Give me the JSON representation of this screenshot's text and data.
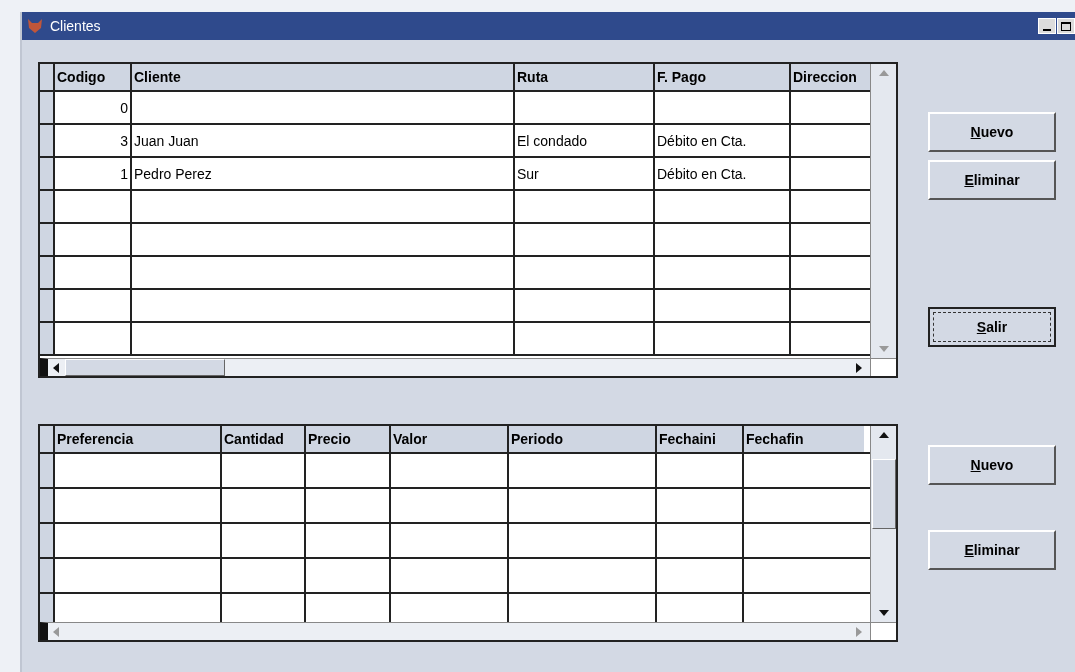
{
  "window": {
    "title": "Clientes"
  },
  "clientes_grid": {
    "columns": [
      "Codigo",
      "Cliente",
      "Ruta",
      "F. Pago",
      "Direccion"
    ],
    "rows": [
      [
        "0",
        "",
        "",
        "",
        ""
      ],
      [
        "3",
        "Juan Juan",
        "El condado",
        "Débito en Cta.",
        ""
      ],
      [
        "1",
        "Pedro Perez",
        "Sur",
        "Débito en Cta.",
        ""
      ]
    ]
  },
  "top_buttons": [
    {
      "label": "Nuevo",
      "underline_first": true,
      "focused": false
    },
    {
      "label": "Eliminar",
      "underline_first": true,
      "focused": false
    },
    {
      "label": "Salir",
      "underline_first": true,
      "focused": true
    }
  ],
  "preferencias_grid": {
    "columns": [
      "Preferencia",
      "Cantidad",
      "Precio",
      "Valor",
      "Periodo",
      "Fechaini",
      "Fechafin"
    ]
  },
  "bottom_buttons": [
    {
      "label": "Nuevo",
      "underline_first": true,
      "focused": false
    },
    {
      "label": "Eliminar",
      "underline_first": true,
      "focused": false
    }
  ]
}
